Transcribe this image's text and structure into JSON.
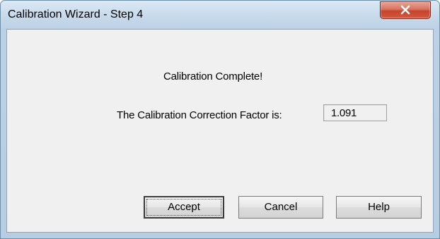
{
  "window": {
    "title": "Calibration Wizard - Step 4",
    "close_icon": "close-icon"
  },
  "content": {
    "complete_message": "Calibration Complete!",
    "factor_label": "The Calibration Correction Factor is:",
    "factor_value": "1.091"
  },
  "buttons": {
    "accept_label": "Accept",
    "cancel_label": "Cancel",
    "help_label": "Help"
  },
  "colors": {
    "title_bar": "#c9dbec",
    "close_button": "#c7432b",
    "dialog_background": "#f0f0f0"
  }
}
